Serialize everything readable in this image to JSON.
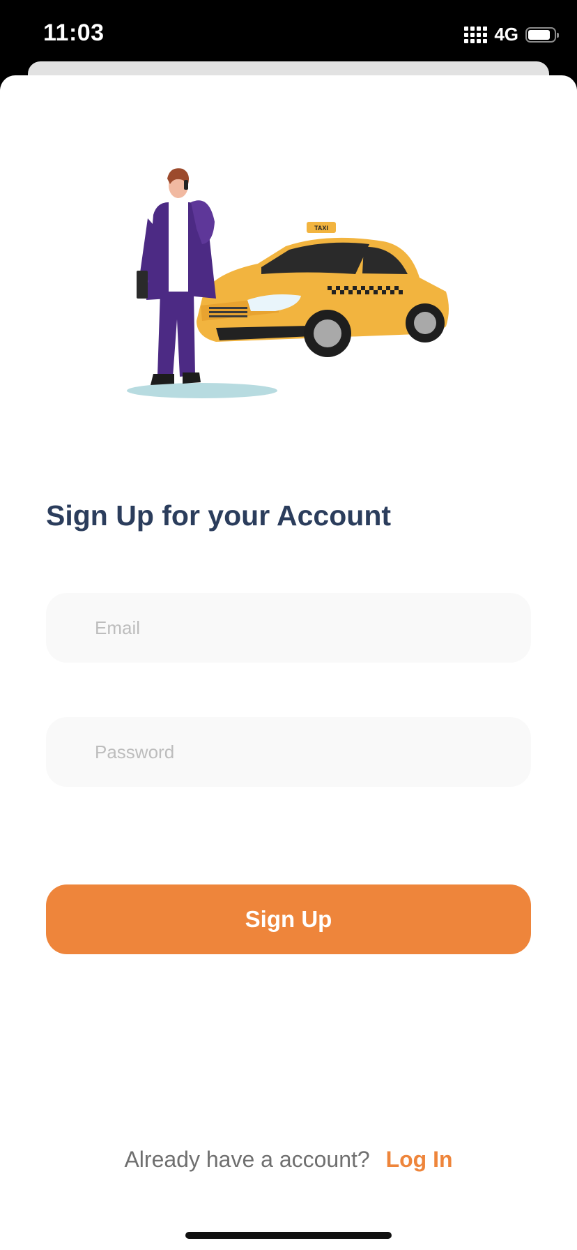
{
  "status_bar": {
    "time": "11:03",
    "network": "4G",
    "battery_level": 0.75
  },
  "hero": {
    "illustration": "man-on-phone-with-taxi",
    "taxi_sign": "TAXI"
  },
  "title": "Sign Up for your Account",
  "email": {
    "placeholder": "Email",
    "value": ""
  },
  "password": {
    "placeholder": "Password",
    "value": ""
  },
  "signup_button": {
    "label": "Sign Up"
  },
  "footer": {
    "prompt": "Already have a account?",
    "login_label": "Log In"
  },
  "colors": {
    "accent": "#ee853b",
    "title": "#2b3d5c",
    "field_background": "#f9f9f9",
    "taxi_yellow": "#f2b43f",
    "suit_purple": "#4c2a84"
  }
}
